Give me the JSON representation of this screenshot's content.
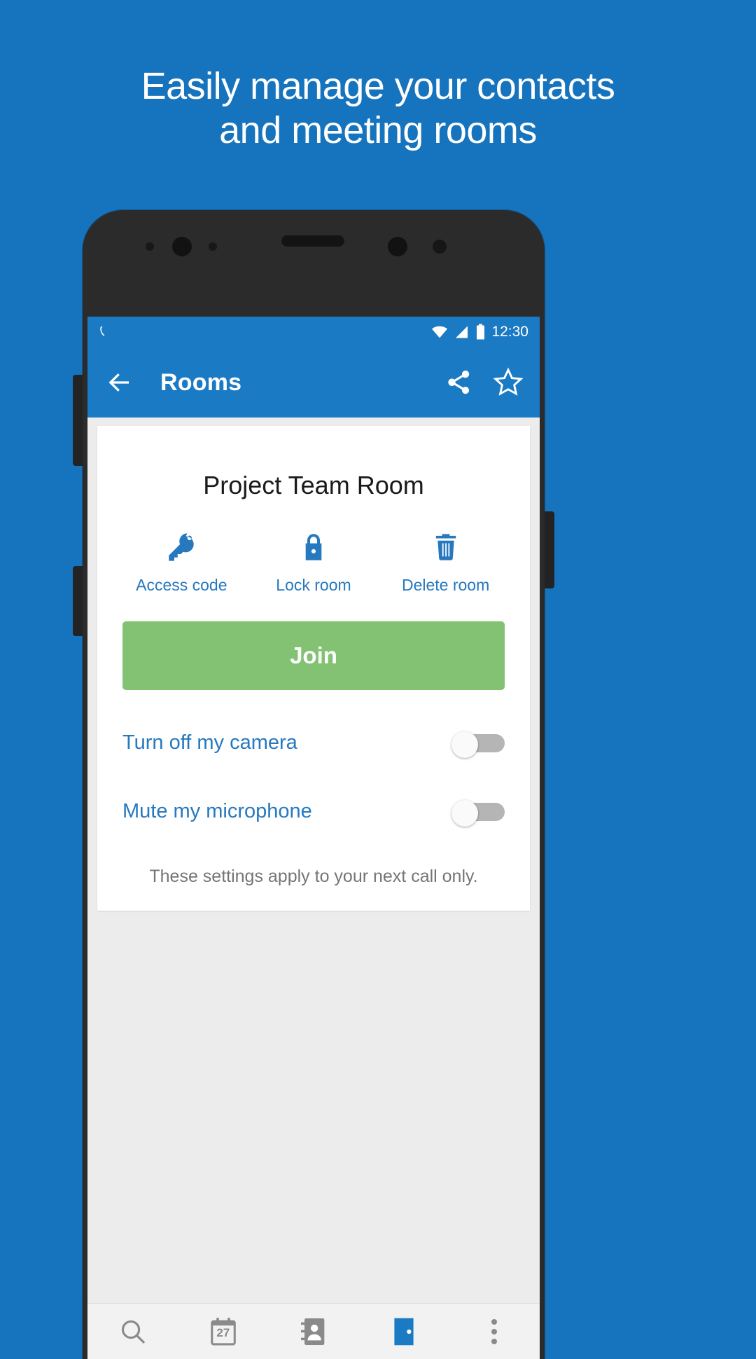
{
  "promo": {
    "line1": "Easily manage your contacts",
    "line2": "and meeting rooms"
  },
  "colors": {
    "background": "#1673bd",
    "app_bar": "#1b7ac4",
    "accent_blue": "#2678bf",
    "join_green": "#82c272",
    "screen_background": "#ececec",
    "card": "#ffffff",
    "note_gray": "#757575",
    "switch_track": "#b5b5b5"
  },
  "status_bar": {
    "call_icon": "phone-call-icon",
    "wifi_icon": "wifi-icon",
    "signal_icon": "cellular-signal-icon",
    "battery_icon": "battery-full-icon",
    "clock": "12:30"
  },
  "app_bar": {
    "back_icon": "arrow-left-icon",
    "title": "Rooms",
    "share_icon": "share-icon",
    "favorite_icon": "star-outline-icon"
  },
  "card": {
    "room_title": "Project Team Room",
    "actions": [
      {
        "icon": "key-icon",
        "label": "Access code"
      },
      {
        "icon": "lock-icon",
        "label": "Lock room"
      },
      {
        "icon": "trash-icon",
        "label": "Delete room"
      }
    ],
    "join_label": "Join",
    "toggles": [
      {
        "label": "Turn off my camera",
        "state": "off"
      },
      {
        "label": "Mute my microphone",
        "state": "off"
      }
    ],
    "note": "These settings apply to your next call only."
  },
  "bottom_nav": {
    "items": [
      {
        "icon": "search-icon",
        "label": "",
        "active": false
      },
      {
        "icon": "calendar-icon",
        "label": "27",
        "active": false
      },
      {
        "icon": "contacts-icon",
        "label": "",
        "active": false
      },
      {
        "icon": "rooms-icon",
        "label": "",
        "active": true
      },
      {
        "icon": "more-vertical-icon",
        "label": "",
        "active": false
      }
    ]
  }
}
